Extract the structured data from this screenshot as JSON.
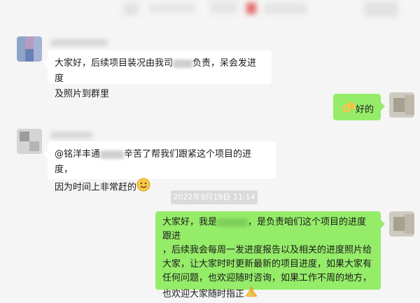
{
  "messages": [
    {
      "side": "left",
      "line1": "大家好，后续项目装况由我司",
      "line1_after": "负责，呆会发进度",
      "line2": "及照片到群里"
    },
    {
      "side": "right",
      "emoji": "ok-hand-icon",
      "text": "好的"
    },
    {
      "side": "left",
      "line1_prefix": "@铭洋丰通",
      "line1_after": "辛苦了帮我们跟紧这个项目的进度，",
      "line2": "因为时间上非常赶的",
      "emoji": "smile-icon"
    },
    {
      "side": "right",
      "line1_a": "大家好，我是",
      "line1_b": "，是负责咱们这个项目的进度跟进",
      "line2": "，后续我会每周一发进度报告以及相关的进度照片给",
      "line3": "大家，让大家时时更新最新的项目进度，如果大家有",
      "line4": "任何问题，也欢迎随时咨询，如果工作不周的地方，",
      "line5": "也欢迎大家随时指正",
      "emoji": "pray-icon"
    }
  ],
  "timestamp": "2022年9月19日 11:14",
  "colors": {
    "background": "#f5f5f5",
    "bubble_self": "#95ec69",
    "bubble_other": "#ffffff",
    "timestamp_bg": "#dadada"
  }
}
